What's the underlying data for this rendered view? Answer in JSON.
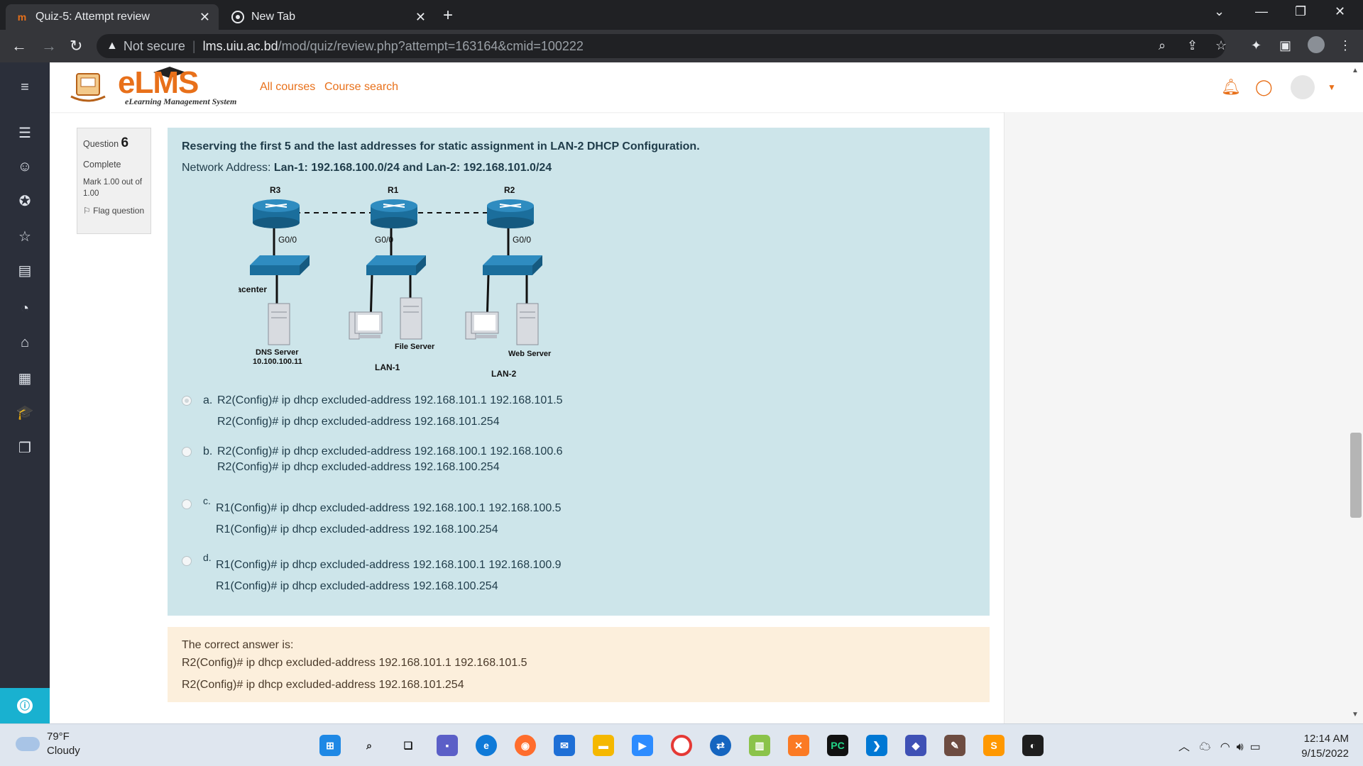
{
  "browser": {
    "tabs": [
      {
        "title": "Quiz-5: Attempt review",
        "favicon": "moodle-m-icon",
        "active": true
      },
      {
        "title": "New Tab",
        "favicon": "chrome-icon",
        "active": false
      }
    ],
    "new_tab": "+",
    "address": {
      "security_label": "Not secure",
      "host": "lms.uiu.ac.bd",
      "path": "/mod/quiz/review.php?attempt=163164&cmid=100222"
    }
  },
  "lms": {
    "logo_text": "eLMS",
    "logo_tagline": "eLearning Management System",
    "nav_links": [
      "All courses",
      "Course search"
    ]
  },
  "question_info": {
    "label": "Question",
    "number": "6",
    "state": "Complete",
    "mark": "Mark 1.00 out of 1.00",
    "flag": "Flag question"
  },
  "question": {
    "text": "Reserving the first 5 and the last addresses for static assignment in LAN-2 DHCP Configuration.",
    "network_prefix": "Network Address: ",
    "network_value": "Lan-1: 192.168.100.0/24 and Lan-2: 192.168.101.0/24",
    "topology": {
      "routers": [
        "R3",
        "R1",
        "R2"
      ],
      "interfaces": [
        "G0/0",
        "G0/0",
        "G0/0"
      ],
      "datacenter": "Datacenter",
      "dns_name": "DNS Server",
      "dns_ip": "10.100.100.11",
      "file_server": "File Server",
      "web_server": "Web Server",
      "lan1": "LAN-1",
      "lan2": "LAN-2"
    },
    "options": [
      {
        "letter": "a.",
        "selected": true,
        "lines": [
          "R2(Config)# ip dhcp excluded-address 192.168.101.1 192.168.101.5",
          "R2(Config)# ip dhcp excluded-address 192.168.101.254"
        ]
      },
      {
        "letter": "b.",
        "selected": false,
        "lines": [
          "R2(Config)# ip dhcp excluded-address 192.168.100.1 192.168.100.6",
          "R2(Config)# ip dhcp excluded-address 192.168.100.254"
        ]
      },
      {
        "letter": "c.",
        "selected": false,
        "lines": [
          "R1(Config)# ip dhcp excluded-address 192.168.100.1 192.168.100.5",
          "R1(Config)# ip dhcp excluded-address 192.168.100.254"
        ]
      },
      {
        "letter": "d.",
        "selected": false,
        "lines": [
          "R1(Config)# ip dhcp excluded-address 192.168.100.1 192.168.100.9",
          "R1(Config)# ip dhcp excluded-address 192.168.100.254"
        ]
      }
    ]
  },
  "feedback": {
    "heading": "The correct answer is:",
    "line1": "R2(Config)# ip dhcp excluded-address 192.168.101.1 192.168.101.5",
    "line2": "R2(Config)# ip dhcp excluded-address 192.168.101.254"
  },
  "taskbar": {
    "temperature": "79°F",
    "weather": "Cloudy",
    "time": "12:14 AM",
    "date": "9/15/2022"
  },
  "colors": {
    "brand_orange": "#e8701a",
    "question_bg": "#cde5ea",
    "feedback_bg": "#fcefdc",
    "sidebar_bg": "#2b2f3a",
    "device_blue": "#1b6e9c"
  }
}
